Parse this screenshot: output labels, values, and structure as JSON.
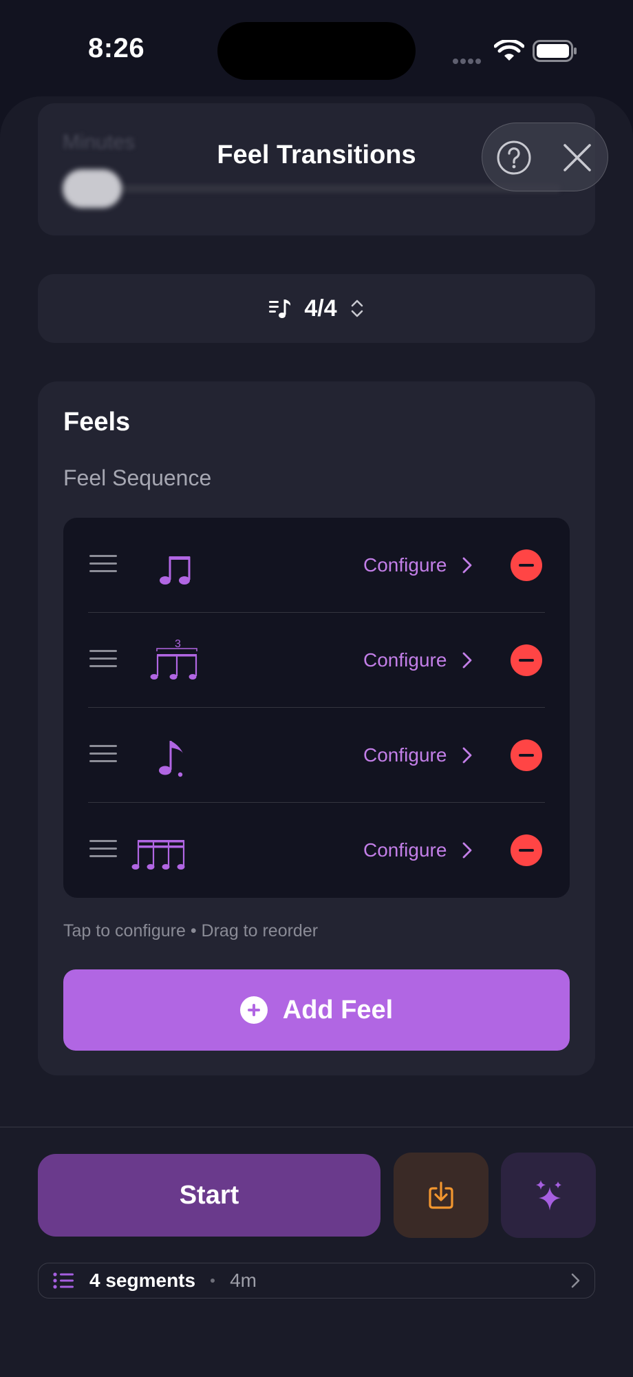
{
  "status_bar": {
    "time": "8:26"
  },
  "background_card": {
    "label": "Minutes"
  },
  "nav": {
    "title": "Feel Transitions",
    "help_icon": "question-circle-icon",
    "close_icon": "close-x-icon"
  },
  "time_signature": {
    "value": "4/4",
    "icon": "music-list-icon",
    "chevron": "up-down-chevron-icon"
  },
  "feels": {
    "title": "Feels",
    "subtitle": "Feel Sequence",
    "items": [
      {
        "icon": "eighth-notes-icon",
        "configure_label": "Configure"
      },
      {
        "icon": "triplet-notes-icon",
        "configure_label": "Configure"
      },
      {
        "icon": "dotted-eighth-note-icon",
        "configure_label": "Configure"
      },
      {
        "icon": "sixteenth-notes-icon",
        "configure_label": "Configure"
      }
    ],
    "hint": "Tap to configure • Drag to reorder",
    "add_label": "Add Feel"
  },
  "footer": {
    "start_label": "Start",
    "segments_count": "4 segments",
    "segments_duration": "4m"
  },
  "colors": {
    "accent": "#b166e3",
    "accent_text": "#c37fe8",
    "destructive": "#ff4545",
    "start_button": "#6a3a8c",
    "import_icon": "#f2962f",
    "background": "#121320",
    "card": "#232432"
  }
}
